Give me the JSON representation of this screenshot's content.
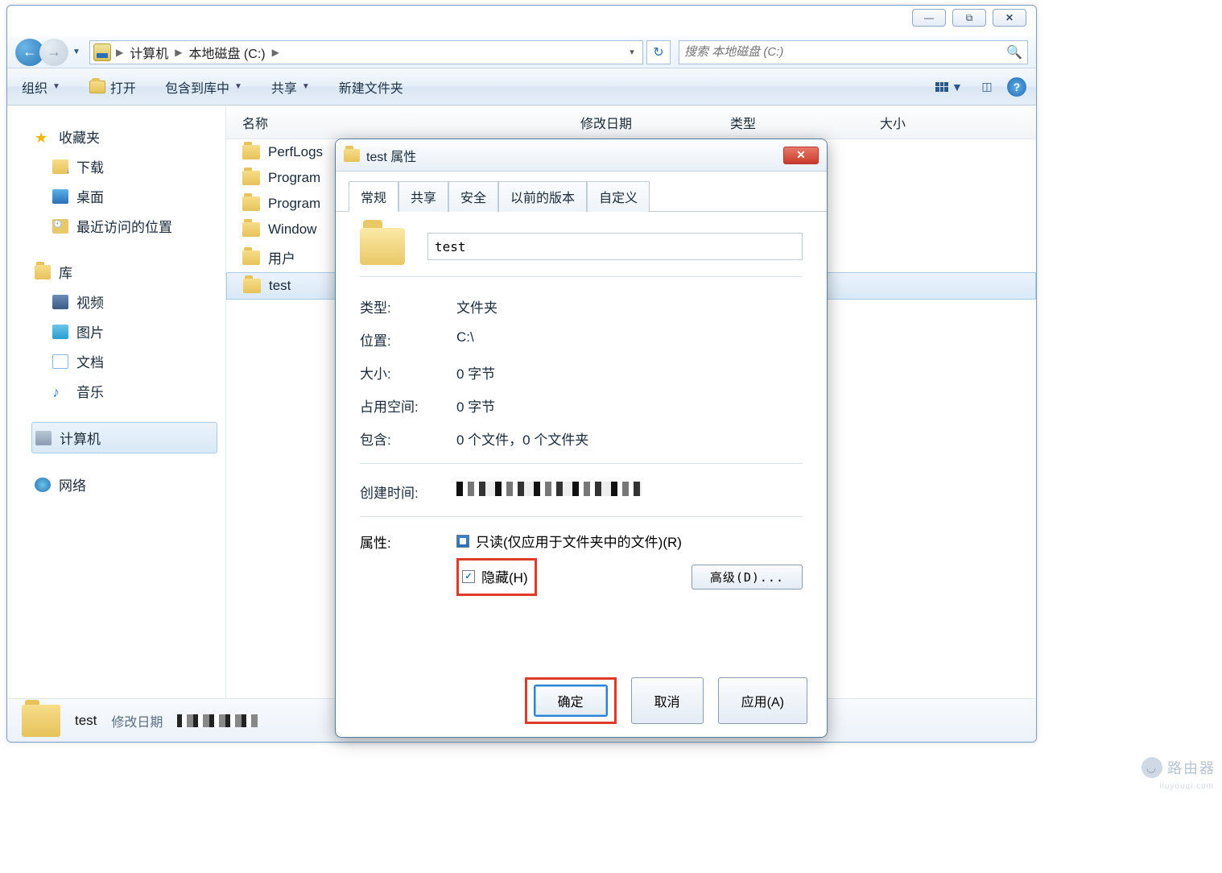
{
  "title_controls": {
    "min": "—",
    "max": "⧉",
    "close": "✕"
  },
  "breadcrumb": {
    "root": "计算机",
    "drive": "本地磁盘 (C:)"
  },
  "search": {
    "placeholder": "搜索 本地磁盘 (C:)"
  },
  "toolbar": {
    "organize": "组织",
    "open": "打开",
    "include": "包含到库中",
    "share": "共享",
    "new_folder": "新建文件夹"
  },
  "columns": {
    "name": "名称",
    "modified": "修改日期",
    "type": "类型",
    "size": "大小"
  },
  "tree": {
    "favorites": "收藏夹",
    "downloads": "下载",
    "desktop": "桌面",
    "recent": "最近访问的位置",
    "libraries": "库",
    "videos": "视频",
    "pictures": "图片",
    "documents": "文档",
    "music": "音乐",
    "computer": "计算机",
    "network": "网络"
  },
  "files": [
    {
      "name": "PerfLogs"
    },
    {
      "name": "Program"
    },
    {
      "name": "Program"
    },
    {
      "name": "Window"
    },
    {
      "name": "用户"
    },
    {
      "name": "test"
    }
  ],
  "details": {
    "name": "test",
    "mod_label": "修改日期"
  },
  "dialog": {
    "title": "test 属性",
    "tabs": {
      "general": "常规",
      "sharing": "共享",
      "security": "安全",
      "previous": "以前的版本",
      "custom": "自定义"
    },
    "name_value": "test",
    "rows": {
      "type_lbl": "类型:",
      "type_val": "文件夹",
      "loc_lbl": "位置:",
      "loc_val": "C:\\",
      "size_lbl": "大小:",
      "size_val": "0 字节",
      "ondisk_lbl": "占用空间:",
      "ondisk_val": "0 字节",
      "contains_lbl": "包含:",
      "contains_val": "0 个文件，0 个文件夹",
      "created_lbl": "创建时间:"
    },
    "attributes": {
      "label": "属性:",
      "readonly": "只读(仅应用于文件夹中的文件)(R)",
      "hidden": "隐藏(H)",
      "advanced": "高级(D)..."
    },
    "buttons": {
      "ok": "确定",
      "cancel": "取消",
      "apply": "应用(A)"
    }
  },
  "watermark": {
    "text": "路由器",
    "sub": "iluyouqi.com"
  }
}
